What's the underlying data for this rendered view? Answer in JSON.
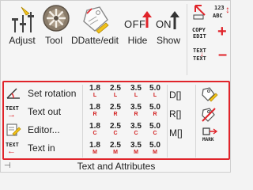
{
  "group_title": "Text and Attributes",
  "top_buttons": [
    {
      "id": "adjust",
      "label": "Adjust"
    },
    {
      "id": "tool",
      "label": "Tool"
    },
    {
      "id": "ddatte",
      "label": "DDatte/edit"
    },
    {
      "id": "hide",
      "label": "Hide",
      "icon_text": "OFF"
    },
    {
      "id": "show",
      "label": "Show",
      "icon_text": "ON"
    }
  ],
  "small_buttons": {
    "numbers": "123",
    "abc": "ABC",
    "copy_edit": [
      "COPY",
      "EDIT"
    ],
    "text_text": [
      "TEXT",
      "TEXT"
    ]
  },
  "commands": [
    {
      "label": "Set rotation",
      "icon": "rotation-icon"
    },
    {
      "label": "Text out",
      "icon": "text-out-icon",
      "icon_text": "TEXT"
    },
    {
      "label": "Editor...",
      "icon": "editor-icon"
    },
    {
      "label": "Text in",
      "icon": "text-in-icon",
      "icon_text": "TEXT"
    }
  ],
  "size_grid": {
    "values": [
      "1.8",
      "2.5",
      "3.5",
      "5.0"
    ],
    "rows": [
      {
        "suffix": "L"
      },
      {
        "suffix": "R"
      },
      {
        "suffix": "C"
      },
      {
        "suffix": "M"
      }
    ]
  },
  "justify_buttons": [
    "D[]",
    "R[]",
    "M[]"
  ],
  "right_icons": [
    "edit-attribute-icon",
    "delete-attribute-icon",
    "mark-icon"
  ],
  "mark_label": "MARK",
  "colors": {
    "accent_red": "#e0242a",
    "icon_red": "#d21e1e",
    "border": "#cfcfcf"
  }
}
